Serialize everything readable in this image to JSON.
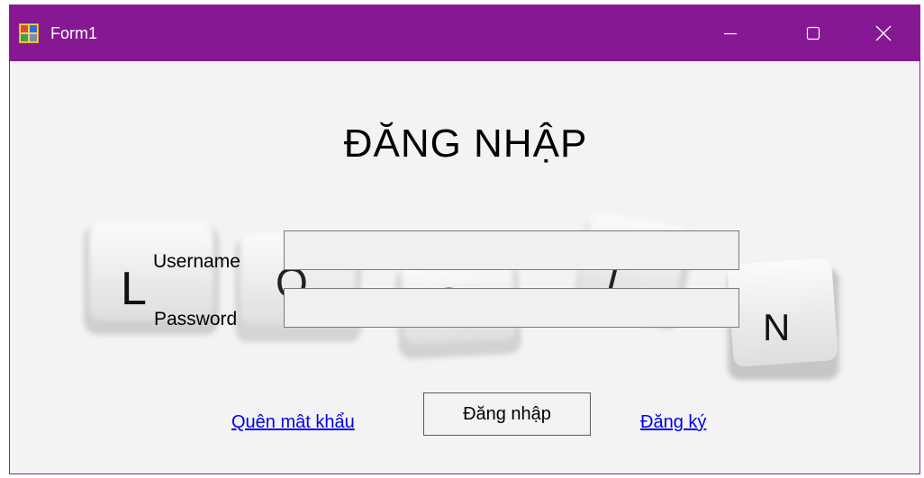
{
  "window": {
    "title": "Form1",
    "accent_color": "#861893",
    "icons": {
      "app": "winforms-app-icon",
      "minimize": "minimize-icon",
      "maximize": "maximize-icon",
      "close": "close-icon"
    }
  },
  "form": {
    "heading": "ĐĂNG NHẬP",
    "username_label": "Username",
    "username_value": "",
    "password_label": "Password",
    "password_value": "",
    "forgot_link": "Quên mât khẩu",
    "login_button": "Đăng nhập",
    "register_link": "Đăng ký"
  },
  "background": {
    "description_tiles": [
      "L",
      "O",
      "G",
      "I",
      "N"
    ]
  }
}
